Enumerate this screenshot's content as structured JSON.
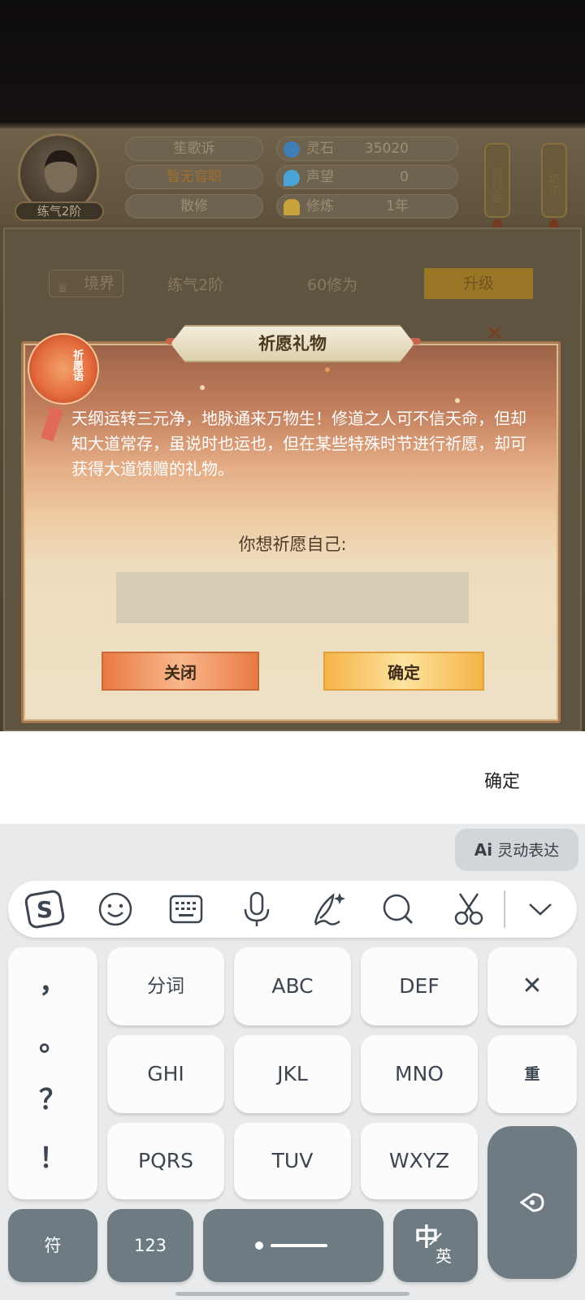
{
  "game": {
    "player": {
      "name": "笙歌诉",
      "title": "暂无官职",
      "sect": "散修",
      "level_tag": "练气2阶"
    },
    "resources": [
      {
        "label": "灵石",
        "value": "35020",
        "icon": "spirit-stone-icon",
        "color": "#3f7fb5"
      },
      {
        "label": "声望",
        "value": "0",
        "icon": "reputation-icon",
        "color": "#4aa3d6"
      },
      {
        "label": "修炼",
        "value": "1年",
        "icon": "meditation-icon",
        "color": "#c9a23a"
      }
    ],
    "lanterns": [
      "奇珍会",
      "坊市"
    ],
    "realm": {
      "tag": "境界",
      "current": "练气2阶",
      "requirement": "60修为",
      "upgrade_label": "升级"
    },
    "behind_close": "✕"
  },
  "dialog": {
    "title": "祈愿礼物",
    "badge_text": "祈愿语",
    "body": "天纲运转三元净，地脉通来万物生！修道之人可不信天命，但却知大道常存，虽说时也运也，但在某些特殊时节进行祈愿，却可获得大道馈赠的礼物。",
    "question": "你想祈愿自己:",
    "input_value": "",
    "close_label": "关闭",
    "confirm_label": "确定"
  },
  "compose": {
    "confirm_text": "确定"
  },
  "keyboard": {
    "ai_prefix": "Ai",
    "ai_label": "灵动表达",
    "toolbar": [
      "sogou-logo-icon",
      "emoji-icon",
      "keyboard-icon",
      "microphone-icon",
      "handwriting-icon",
      "search-icon",
      "clipboard-scissors-icon",
      "collapse-chevron-icon"
    ],
    "punct": [
      "，",
      "。",
      "？",
      "！"
    ],
    "row1": [
      "分词",
      "ABC",
      "DEF"
    ],
    "row2": [
      "GHI",
      "JKL",
      "MNO"
    ],
    "row3": [
      "PQRS",
      "TUV",
      "WXYZ"
    ],
    "delete_glyph": "✕",
    "reenter_label": "重",
    "symbols_label": "符",
    "numbers_label": "123",
    "lang_main": "中",
    "lang_sub": "英"
  }
}
